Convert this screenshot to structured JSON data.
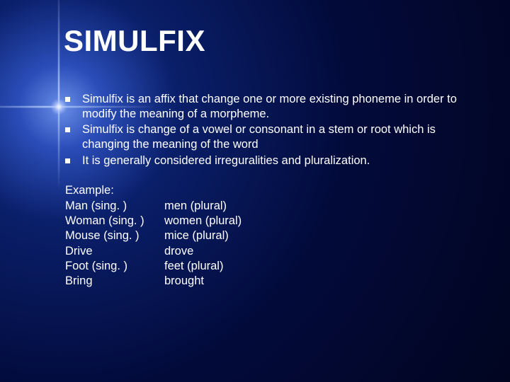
{
  "title": "SIMULFIX",
  "bullets": [
    "Simulfix is an affix that change one or more existing phoneme in order to modify the meaning of a morpheme.",
    "Simulfix is change of a vowel or consonant in a stem or root which is changing the meaning of the word",
    "It is generally considered irreguralities and pluralization."
  ],
  "example_label": "Example:",
  "examples": [
    {
      "left": "Man (sing. )",
      "right": "men (plural)"
    },
    {
      "left": "Woman (sing. )",
      "right": "women (plural)"
    },
    {
      "left": "Mouse (sing. )",
      "right": "mice (plural)"
    },
    {
      "left": "Drive",
      "right": "drove"
    },
    {
      "left": "Foot (sing. )",
      "right": "feet (plural)"
    },
    {
      "left": "Bring",
      "right": "brought"
    }
  ]
}
